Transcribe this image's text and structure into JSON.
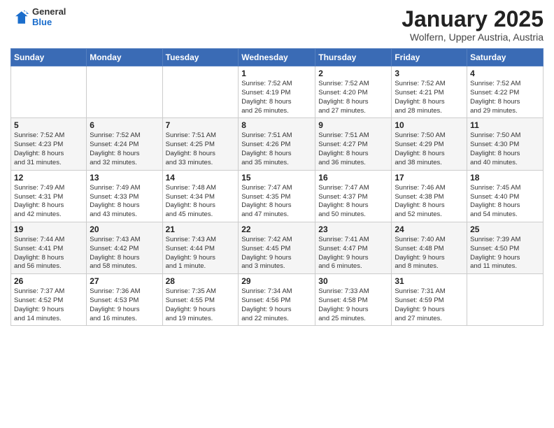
{
  "logo": {
    "general": "General",
    "blue": "Blue"
  },
  "header": {
    "month": "January 2025",
    "location": "Wolfern, Upper Austria, Austria"
  },
  "weekdays": [
    "Sunday",
    "Monday",
    "Tuesday",
    "Wednesday",
    "Thursday",
    "Friday",
    "Saturday"
  ],
  "weeks": [
    [
      {
        "day": "",
        "info": ""
      },
      {
        "day": "",
        "info": ""
      },
      {
        "day": "",
        "info": ""
      },
      {
        "day": "1",
        "info": "Sunrise: 7:52 AM\nSunset: 4:19 PM\nDaylight: 8 hours\nand 26 minutes."
      },
      {
        "day": "2",
        "info": "Sunrise: 7:52 AM\nSunset: 4:20 PM\nDaylight: 8 hours\nand 27 minutes."
      },
      {
        "day": "3",
        "info": "Sunrise: 7:52 AM\nSunset: 4:21 PM\nDaylight: 8 hours\nand 28 minutes."
      },
      {
        "day": "4",
        "info": "Sunrise: 7:52 AM\nSunset: 4:22 PM\nDaylight: 8 hours\nand 29 minutes."
      }
    ],
    [
      {
        "day": "5",
        "info": "Sunrise: 7:52 AM\nSunset: 4:23 PM\nDaylight: 8 hours\nand 31 minutes."
      },
      {
        "day": "6",
        "info": "Sunrise: 7:52 AM\nSunset: 4:24 PM\nDaylight: 8 hours\nand 32 minutes."
      },
      {
        "day": "7",
        "info": "Sunrise: 7:51 AM\nSunset: 4:25 PM\nDaylight: 8 hours\nand 33 minutes."
      },
      {
        "day": "8",
        "info": "Sunrise: 7:51 AM\nSunset: 4:26 PM\nDaylight: 8 hours\nand 35 minutes."
      },
      {
        "day": "9",
        "info": "Sunrise: 7:51 AM\nSunset: 4:27 PM\nDaylight: 8 hours\nand 36 minutes."
      },
      {
        "day": "10",
        "info": "Sunrise: 7:50 AM\nSunset: 4:29 PM\nDaylight: 8 hours\nand 38 minutes."
      },
      {
        "day": "11",
        "info": "Sunrise: 7:50 AM\nSunset: 4:30 PM\nDaylight: 8 hours\nand 40 minutes."
      }
    ],
    [
      {
        "day": "12",
        "info": "Sunrise: 7:49 AM\nSunset: 4:31 PM\nDaylight: 8 hours\nand 42 minutes."
      },
      {
        "day": "13",
        "info": "Sunrise: 7:49 AM\nSunset: 4:33 PM\nDaylight: 8 hours\nand 43 minutes."
      },
      {
        "day": "14",
        "info": "Sunrise: 7:48 AM\nSunset: 4:34 PM\nDaylight: 8 hours\nand 45 minutes."
      },
      {
        "day": "15",
        "info": "Sunrise: 7:47 AM\nSunset: 4:35 PM\nDaylight: 8 hours\nand 47 minutes."
      },
      {
        "day": "16",
        "info": "Sunrise: 7:47 AM\nSunset: 4:37 PM\nDaylight: 8 hours\nand 50 minutes."
      },
      {
        "day": "17",
        "info": "Sunrise: 7:46 AM\nSunset: 4:38 PM\nDaylight: 8 hours\nand 52 minutes."
      },
      {
        "day": "18",
        "info": "Sunrise: 7:45 AM\nSunset: 4:40 PM\nDaylight: 8 hours\nand 54 minutes."
      }
    ],
    [
      {
        "day": "19",
        "info": "Sunrise: 7:44 AM\nSunset: 4:41 PM\nDaylight: 8 hours\nand 56 minutes."
      },
      {
        "day": "20",
        "info": "Sunrise: 7:43 AM\nSunset: 4:42 PM\nDaylight: 8 hours\nand 58 minutes."
      },
      {
        "day": "21",
        "info": "Sunrise: 7:43 AM\nSunset: 4:44 PM\nDaylight: 9 hours\nand 1 minute."
      },
      {
        "day": "22",
        "info": "Sunrise: 7:42 AM\nSunset: 4:45 PM\nDaylight: 9 hours\nand 3 minutes."
      },
      {
        "day": "23",
        "info": "Sunrise: 7:41 AM\nSunset: 4:47 PM\nDaylight: 9 hours\nand 6 minutes."
      },
      {
        "day": "24",
        "info": "Sunrise: 7:40 AM\nSunset: 4:48 PM\nDaylight: 9 hours\nand 8 minutes."
      },
      {
        "day": "25",
        "info": "Sunrise: 7:39 AM\nSunset: 4:50 PM\nDaylight: 9 hours\nand 11 minutes."
      }
    ],
    [
      {
        "day": "26",
        "info": "Sunrise: 7:37 AM\nSunset: 4:52 PM\nDaylight: 9 hours\nand 14 minutes."
      },
      {
        "day": "27",
        "info": "Sunrise: 7:36 AM\nSunset: 4:53 PM\nDaylight: 9 hours\nand 16 minutes."
      },
      {
        "day": "28",
        "info": "Sunrise: 7:35 AM\nSunset: 4:55 PM\nDaylight: 9 hours\nand 19 minutes."
      },
      {
        "day": "29",
        "info": "Sunrise: 7:34 AM\nSunset: 4:56 PM\nDaylight: 9 hours\nand 22 minutes."
      },
      {
        "day": "30",
        "info": "Sunrise: 7:33 AM\nSunset: 4:58 PM\nDaylight: 9 hours\nand 25 minutes."
      },
      {
        "day": "31",
        "info": "Sunrise: 7:31 AM\nSunset: 4:59 PM\nDaylight: 9 hours\nand 27 minutes."
      },
      {
        "day": "",
        "info": ""
      }
    ]
  ]
}
